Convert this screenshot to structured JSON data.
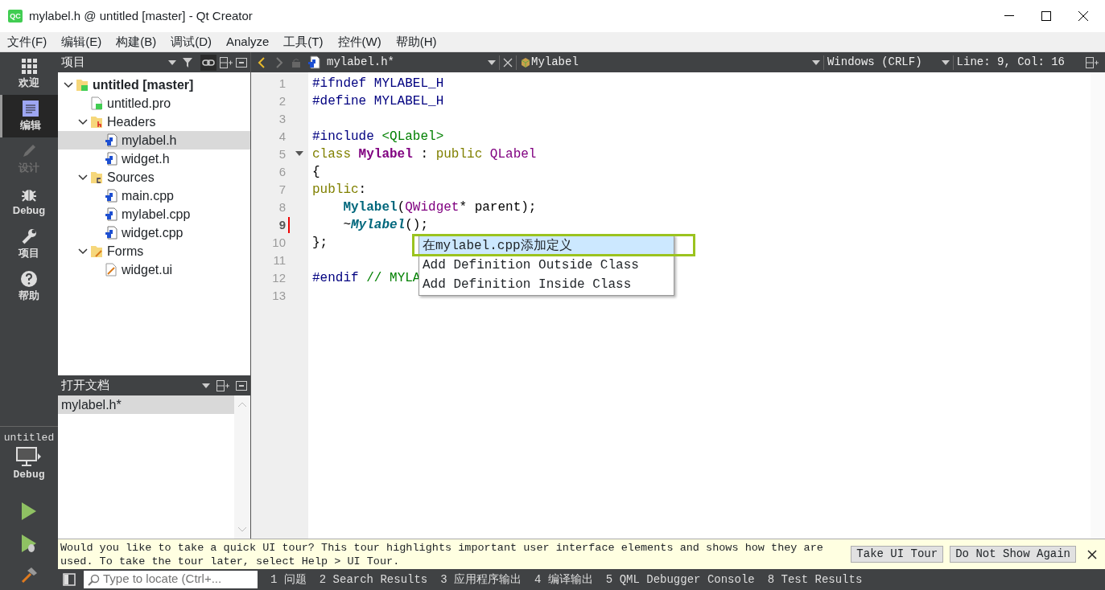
{
  "window": {
    "app_icon_text": "QC",
    "title": "mylabel.h @ untitled [master] - Qt Creator"
  },
  "menu": [
    "文件(F)",
    "编辑(E)",
    "构建(B)",
    "调试(D)",
    "Analyze",
    "工具(T)",
    "控件(W)",
    "帮助(H)"
  ],
  "mode_bar": {
    "modes": [
      {
        "label": "欢迎",
        "kind": "welcome",
        "selected": false,
        "disabled": false
      },
      {
        "label": "编辑",
        "kind": "edit",
        "selected": true,
        "disabled": false
      },
      {
        "label": "设计",
        "kind": "design",
        "selected": false,
        "disabled": true
      },
      {
        "label": "Debug",
        "kind": "debug",
        "selected": false,
        "disabled": false
      },
      {
        "label": "项目",
        "kind": "projects",
        "selected": false,
        "disabled": false
      },
      {
        "label": "帮助",
        "kind": "help",
        "selected": false,
        "disabled": false
      }
    ],
    "target": {
      "project": "untitled",
      "config": "Debug"
    }
  },
  "projects_panel": {
    "title": "项目",
    "tree": [
      {
        "label": "untitled [master]",
        "kind": "project",
        "expanded": true,
        "selected": false,
        "children": [
          {
            "label": "untitled.pro",
            "kind": "pro",
            "selected": false
          },
          {
            "label": "Headers",
            "kind": "headers-folder",
            "expanded": true,
            "selected": false,
            "children": [
              {
                "label": "mylabel.h",
                "kind": "file",
                "selected": true
              },
              {
                "label": "widget.h",
                "kind": "file",
                "selected": false
              }
            ]
          },
          {
            "label": "Sources",
            "kind": "sources-folder",
            "expanded": true,
            "selected": false,
            "children": [
              {
                "label": "main.cpp",
                "kind": "file",
                "selected": false
              },
              {
                "label": "mylabel.cpp",
                "kind": "file",
                "selected": false
              },
              {
                "label": "widget.cpp",
                "kind": "file",
                "selected": false
              }
            ]
          },
          {
            "label": "Forms",
            "kind": "forms-folder",
            "expanded": true,
            "selected": false,
            "children": [
              {
                "label": "widget.ui",
                "kind": "form",
                "selected": false
              }
            ]
          }
        ]
      }
    ]
  },
  "open_documents": {
    "title": "打开文档",
    "items": [
      {
        "label": "mylabel.h*",
        "selected": true
      }
    ]
  },
  "editor": {
    "file": "mylabel.h*",
    "symbol": "Mylabel",
    "line_ending": "Windows (CRLF)",
    "position": "Line: 9, Col: 16",
    "lines": [
      {
        "number": "1",
        "current": false,
        "foldable": false,
        "indented": false,
        "tokens": [
          {
            "kind": "preproc",
            "text": "#ifndef MYLABEL_H"
          }
        ]
      },
      {
        "number": "2",
        "current": false,
        "foldable": false,
        "indented": false,
        "tokens": [
          {
            "kind": "preproc",
            "text": "#define MYLABEL_H"
          }
        ]
      },
      {
        "number": "3",
        "current": false,
        "foldable": false
      },
      {
        "number": "4",
        "current": false,
        "foldable": false,
        "indented": false,
        "tokens": [
          {
            "kind": "preproc",
            "text": "#include "
          },
          {
            "kind": "string",
            "text": "<QLabel>"
          }
        ]
      },
      {
        "number": "5",
        "current": false,
        "foldable": true,
        "indented": false,
        "tokens": [
          {
            "kind": "keyword",
            "text": "class "
          },
          {
            "kind": "class-decl",
            "text": "Mylabel"
          },
          {
            "kind": "plain",
            "text": " : "
          },
          {
            "kind": "keyword",
            "text": "public "
          },
          {
            "kind": "type",
            "text": "QLabel"
          }
        ]
      },
      {
        "number": "6",
        "current": false,
        "foldable": false,
        "indented": false,
        "tokens": [
          {
            "kind": "plain",
            "text": "{"
          }
        ]
      },
      {
        "number": "7",
        "current": false,
        "foldable": false,
        "indented": false,
        "tokens": [
          {
            "kind": "keyword",
            "text": "public"
          },
          {
            "kind": "plain",
            "text": ":"
          }
        ]
      },
      {
        "number": "8",
        "current": false,
        "foldable": false,
        "indented": true,
        "tokens": [
          {
            "kind": "func-decl",
            "text": "Mylabel"
          },
          {
            "kind": "plain",
            "text": "("
          },
          {
            "kind": "type",
            "text": "QWidget"
          },
          {
            "kind": "plain",
            "text": "* parent);"
          }
        ]
      },
      {
        "number": "9",
        "current": true,
        "foldable": false,
        "indented": true,
        "tokens": [
          {
            "kind": "plain",
            "text": "~"
          },
          {
            "kind": "func-virtual",
            "text": "Mylabel"
          },
          {
            "kind": "plain",
            "text": "();"
          }
        ]
      },
      {
        "number": "10",
        "current": false,
        "foldable": false,
        "indented": false,
        "tokens": [
          {
            "kind": "plain",
            "text": "};"
          }
        ]
      },
      {
        "number": "11",
        "current": false,
        "foldable": false
      },
      {
        "number": "12",
        "current": false,
        "foldable": false,
        "indented": false,
        "tokens": [
          {
            "kind": "preproc",
            "text": "#endif "
          },
          {
            "kind": "comment",
            "text": "// MYLA"
          }
        ]
      },
      {
        "number": "13",
        "current": false,
        "foldable": false
      }
    ],
    "popup": [
      {
        "label": "在mylabel.cpp添加定义",
        "selected": true,
        "highlighted": true
      },
      {
        "label": "Add Definition Outside Class",
        "selected": false,
        "highlighted": false
      },
      {
        "label": "Add Definition Inside Class",
        "selected": false,
        "highlighted": false
      }
    ]
  },
  "tour_bar": {
    "message": "Would you like to take a quick UI tour? This tour highlights important user interface elements and shows how they are used. To take the tour later, select Help > UI Tour.",
    "buttons": [
      "Take UI Tour",
      "Do Not Show Again"
    ]
  },
  "status_bar": {
    "locator_placeholder": "Type to locate (Ctrl+...",
    "panes": [
      "1 问题",
      "2 Search Results",
      "3 应用程序输出",
      "4 编译输出",
      "5 QML Debugger Console",
      "8 Test Results"
    ]
  }
}
